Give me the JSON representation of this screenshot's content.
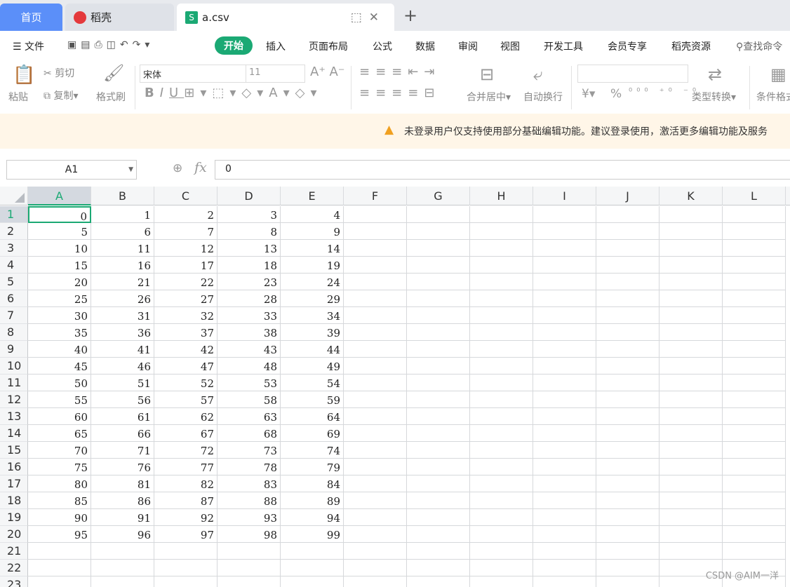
{
  "tabs": {
    "home": "首页",
    "daoke": "稻壳",
    "file": "a.csv"
  },
  "menu": {
    "hamburger": "文件",
    "items": [
      "开始",
      "插入",
      "页面布局",
      "公式",
      "数据",
      "审阅",
      "视图",
      "开发工具",
      "会员专享",
      "稻壳资源"
    ],
    "search": "查找命令"
  },
  "ribbon": {
    "paste": "粘贴",
    "cut": "剪切",
    "copy": "复制",
    "format_painter": "格式刷",
    "font_name": "宋体",
    "font_size": "11",
    "merge": "合并居中",
    "wrap": "自动换行",
    "convert": "类型转换",
    "conditional": "条件格式",
    "currency": "¥",
    "percent": "%"
  },
  "notice": "未登录用户仅支持使用部分基础编辑功能。建议登录使用，激活更多编辑功能及服务",
  "namebox": "A1",
  "formula": "0",
  "columns": [
    "A",
    "B",
    "C",
    "D",
    "E",
    "F",
    "G",
    "H",
    "I",
    "J",
    "K",
    "L"
  ],
  "row_numbers": [
    "1",
    "2",
    "3",
    "4",
    "5",
    "6",
    "7",
    "8",
    "9",
    "10",
    "11",
    "12",
    "13",
    "14",
    "15",
    "16",
    "17",
    "18",
    "19",
    "20",
    "21",
    "22",
    "23"
  ],
  "cells": [
    [
      "0",
      "1",
      "2",
      "3",
      "4"
    ],
    [
      "5",
      "6",
      "7",
      "8",
      "9"
    ],
    [
      "10",
      "11",
      "12",
      "13",
      "14"
    ],
    [
      "15",
      "16",
      "17",
      "18",
      "19"
    ],
    [
      "20",
      "21",
      "22",
      "23",
      "24"
    ],
    [
      "25",
      "26",
      "27",
      "28",
      "29"
    ],
    [
      "30",
      "31",
      "32",
      "33",
      "34"
    ],
    [
      "35",
      "36",
      "37",
      "38",
      "39"
    ],
    [
      "40",
      "41",
      "42",
      "43",
      "44"
    ],
    [
      "45",
      "46",
      "47",
      "48",
      "49"
    ],
    [
      "50",
      "51",
      "52",
      "53",
      "54"
    ],
    [
      "55",
      "56",
      "57",
      "58",
      "59"
    ],
    [
      "60",
      "61",
      "62",
      "63",
      "64"
    ],
    [
      "65",
      "66",
      "67",
      "68",
      "69"
    ],
    [
      "70",
      "71",
      "72",
      "73",
      "74"
    ],
    [
      "75",
      "76",
      "77",
      "78",
      "79"
    ],
    [
      "80",
      "81",
      "82",
      "83",
      "84"
    ],
    [
      "85",
      "86",
      "87",
      "88",
      "89"
    ],
    [
      "90",
      "91",
      "92",
      "93",
      "94"
    ],
    [
      "95",
      "96",
      "97",
      "98",
      "99"
    ]
  ],
  "watermark": "CSDN @AIM一洋"
}
